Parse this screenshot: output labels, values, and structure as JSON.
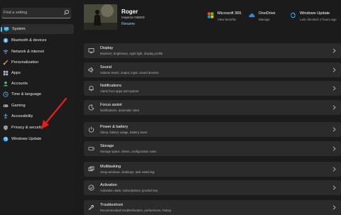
{
  "search": {
    "placeholder": "Find a setting"
  },
  "sidebar": {
    "items": [
      {
        "label": "System",
        "icon": "monitor-icon",
        "color": "#4cc2ff",
        "selected": true
      },
      {
        "label": "Bluetooth & devices",
        "icon": "bluetooth-icon",
        "color": "#4c9bff"
      },
      {
        "label": "Network & internet",
        "icon": "wifi-icon",
        "color": "#7ab8ff"
      },
      {
        "label": "Personalization",
        "icon": "brush-icon",
        "color": "#e8a16b"
      },
      {
        "label": "Apps",
        "icon": "apps-icon",
        "color": "#b3b3d9"
      },
      {
        "label": "Accounts",
        "icon": "person-icon",
        "color": "#3fc878"
      },
      {
        "label": "Time & language",
        "icon": "globe-clock-icon",
        "color": "#5fb4ff"
      },
      {
        "label": "Gaming",
        "icon": "controller-icon",
        "color": "#b0b0b0"
      },
      {
        "label": "Accessibility",
        "icon": "accessibility-icon",
        "color": "#5fb4ff"
      },
      {
        "label": "Privacy & security",
        "icon": "shield-icon",
        "color": "#9a9a9a"
      },
      {
        "label": "Windows Update",
        "icon": "update-icon",
        "color": "#3fa7ff"
      }
    ]
  },
  "user": {
    "name": "Roger",
    "device": "Inspiron N5050",
    "rename": "Rename"
  },
  "quick_links": [
    {
      "title": "Microsoft 365",
      "subtitle": "View benefits",
      "icon": "microsoft-365-icon"
    },
    {
      "title": "OneDrive",
      "subtitle": "Manage",
      "icon": "cloud-icon"
    },
    {
      "title": "Windows Update",
      "subtitle": "Last checked: 2 hours ago",
      "icon": "update-icon"
    }
  ],
  "cards": [
    {
      "title": "Display",
      "subtitle": "Monitors, brightness, night light, display profile",
      "icon": "monitor-icon"
    },
    {
      "title": "Sound",
      "subtitle": "Volume levels, output, input, sound devices",
      "icon": "speaker-icon"
    },
    {
      "title": "Notifications",
      "subtitle": "Alerts from apps and system",
      "icon": "bell-icon"
    },
    {
      "title": "Focus assist",
      "subtitle": "Notifications, automatic rules",
      "icon": "moon-icon"
    },
    {
      "title": "Power & battery",
      "subtitle": "Sleep, battery usage, battery saver",
      "icon": "power-icon"
    },
    {
      "title": "Storage",
      "subtitle": "Storage space, drives, configuration rules",
      "icon": "storage-icon"
    },
    {
      "title": "Multitasking",
      "subtitle": "Snap windows, desktops, task switching",
      "icon": "multitasking-icon"
    },
    {
      "title": "Activation",
      "subtitle": "Activation state, subscriptions, product key",
      "icon": "activation-icon"
    },
    {
      "title": "Troubleshoot",
      "subtitle": "Recommended troubleshooters, preferences, history",
      "icon": "wrench-icon"
    }
  ],
  "colors": {
    "accent": "#4cc2ff",
    "annotation_arrow": "#e81e1e",
    "card": "#2b2b2b",
    "background": "#1b1b1b"
  }
}
